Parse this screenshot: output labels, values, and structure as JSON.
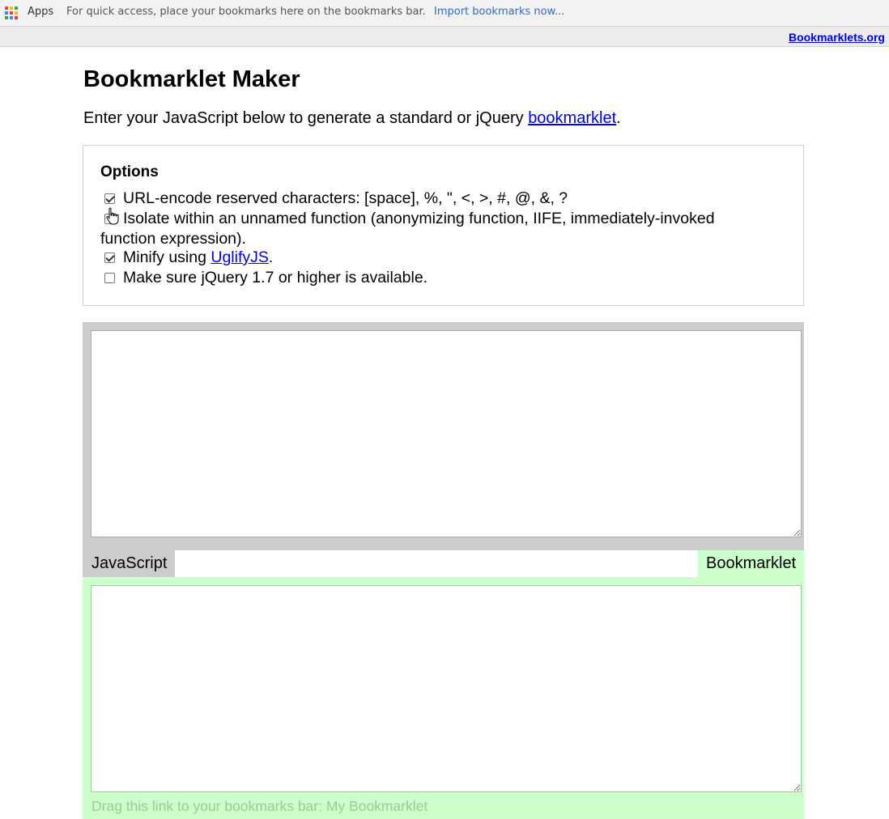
{
  "browser": {
    "apps_label": "Apps",
    "bookmarks_hint": "For quick access, place your bookmarks here on the bookmarks bar.",
    "import_link": "Import bookmarks now...",
    "apps_icon_colors": [
      "#ea4335",
      "#fbbc05",
      "#34a853",
      "#4285f4",
      "#ea4335",
      "#fbbc05",
      "#34a853",
      "#4285f4",
      "#ea4335"
    ]
  },
  "header": {
    "site_link": "Bookmarklets.org"
  },
  "main": {
    "title": "Bookmarklet Maker",
    "intro_before": "Enter your JavaScript below to generate a standard or jQuery ",
    "intro_link": "bookmarklet",
    "intro_after": "."
  },
  "options": {
    "heading": "Options",
    "items": [
      {
        "label": "URL-encode reserved characters: [space], %, \", <, >, #, @, &, ?",
        "checked": true
      },
      {
        "label": "Isolate within an unnamed function (anonymizing function, IIFE, immediately-invoked function expression).",
        "checked": false
      },
      {
        "label_before": "Minify using ",
        "link": "UglifyJS",
        "label_after": ".",
        "checked": true
      },
      {
        "label": "Make sure jQuery 1.7 or higher is available.",
        "checked": false
      }
    ]
  },
  "editor": {
    "javascript_tab": "JavaScript",
    "javascript_value": "",
    "bookmarklet_tab": "Bookmarklet",
    "bookmarklet_value": "",
    "drag_hint": "Drag this link to your bookmarks bar: ",
    "bookmarklet_name": "My Bookmarklet"
  },
  "colors": {
    "js_panel": "#cccccc",
    "bookmarklet_panel": "#ccffcc",
    "link": "#0000ee"
  }
}
